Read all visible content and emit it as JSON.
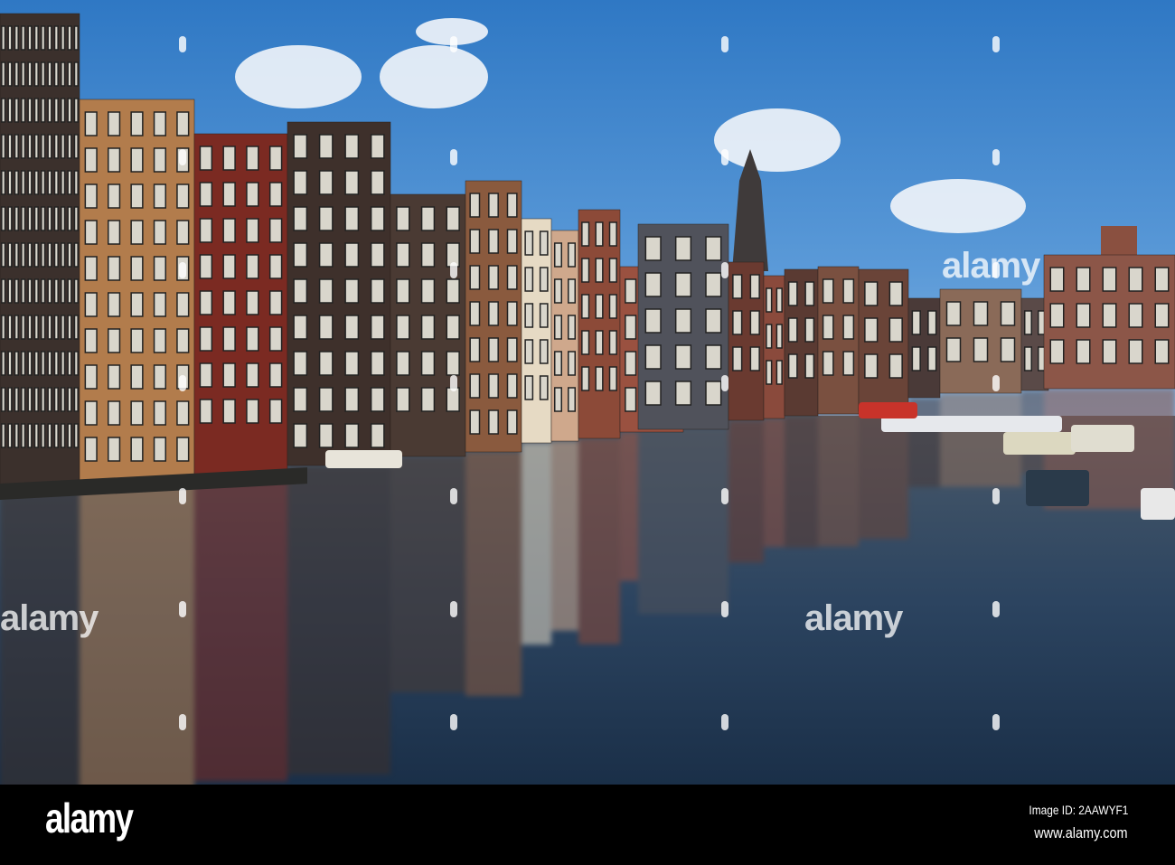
{
  "watermark": {
    "text": "alamy"
  },
  "footer": {
    "logo": "alamy",
    "image_id": "Image ID: 2AAWYF1",
    "url": "www.alamy.com"
  }
}
